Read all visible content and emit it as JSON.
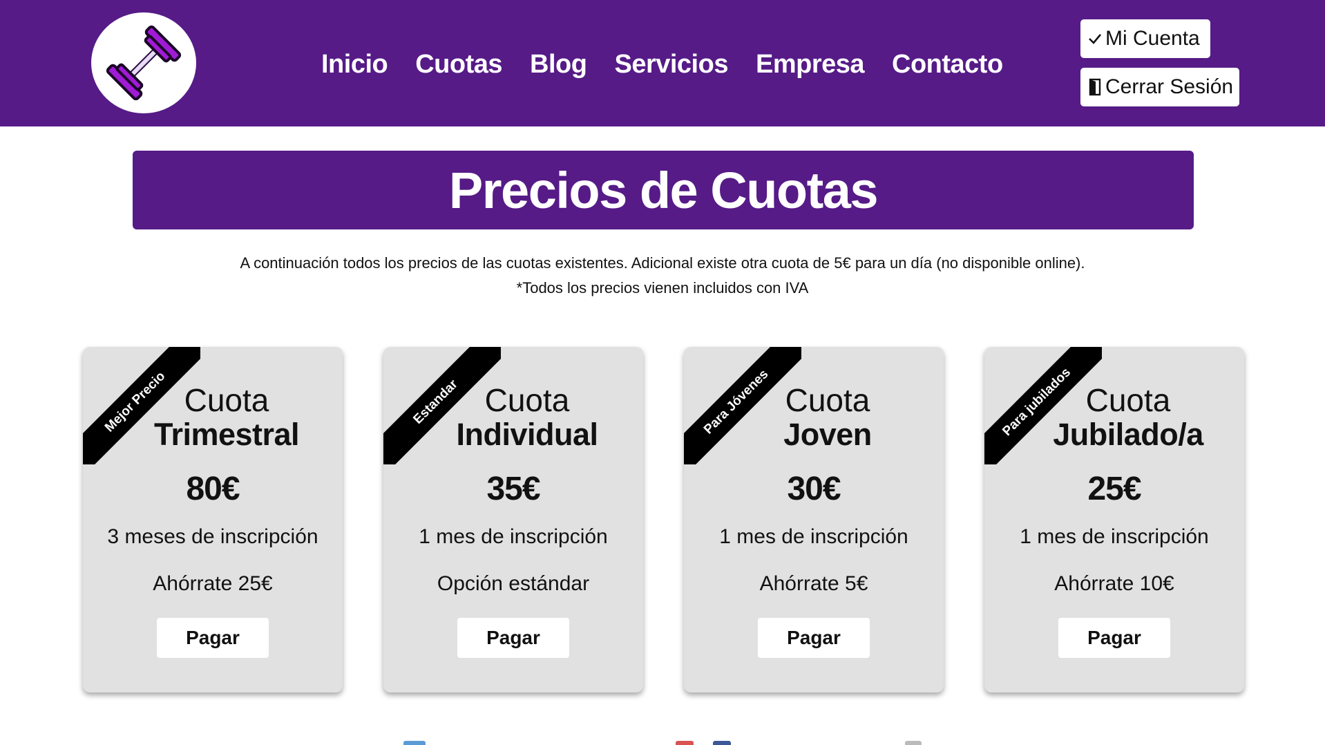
{
  "colors": {
    "brand": "#561b87",
    "card_bg": "#e1e1e1",
    "ribbon": "#000000",
    "button_bg": "#ffffff"
  },
  "logo": {
    "icon": "dumbbell-icon"
  },
  "nav": {
    "links": [
      "Inicio",
      "Cuotas",
      "Blog",
      "Servicios",
      "Empresa",
      "Contacto"
    ]
  },
  "account": {
    "my_account": {
      "label": "Mi Cuenta",
      "icon": "check-icon"
    },
    "logout": {
      "label": "Cerrar Sesión",
      "icon": "door-icon"
    }
  },
  "page_title": "Precios de Cuotas",
  "intro": {
    "line1": "A continuación todos los precios de las cuotas existentes. Adicional existe otra cuota de 5€ para un día (no disponible online).",
    "line2": "*Todos los precios vienen incluidos con IVA"
  },
  "plans": [
    {
      "ribbon": "Mejor Precio",
      "name_line1": "Cuota",
      "name_line2": "Trimestral",
      "price": "80€",
      "period": "3 meses de inscripción",
      "note": "Ahórrate 25€",
      "button": "Pagar"
    },
    {
      "ribbon": "Estandar",
      "name_line1": "Cuota",
      "name_line2": "Individual",
      "price": "35€",
      "period": "1 mes de inscripción",
      "note": "Opción estándar",
      "button": "Pagar"
    },
    {
      "ribbon": "Para Jóvenes",
      "name_line1": "Cuota",
      "name_line2": "Joven",
      "price": "30€",
      "period": "1 mes de inscripción",
      "note": "Ahórrate 5€",
      "button": "Pagar"
    },
    {
      "ribbon": "Para jubilados",
      "name_line1": "Cuota",
      "name_line2": "Jubilado/a",
      "price": "25€",
      "period": "1 mes de inscripción",
      "note": "Ahórrate 10€",
      "button": "Pagar"
    }
  ]
}
